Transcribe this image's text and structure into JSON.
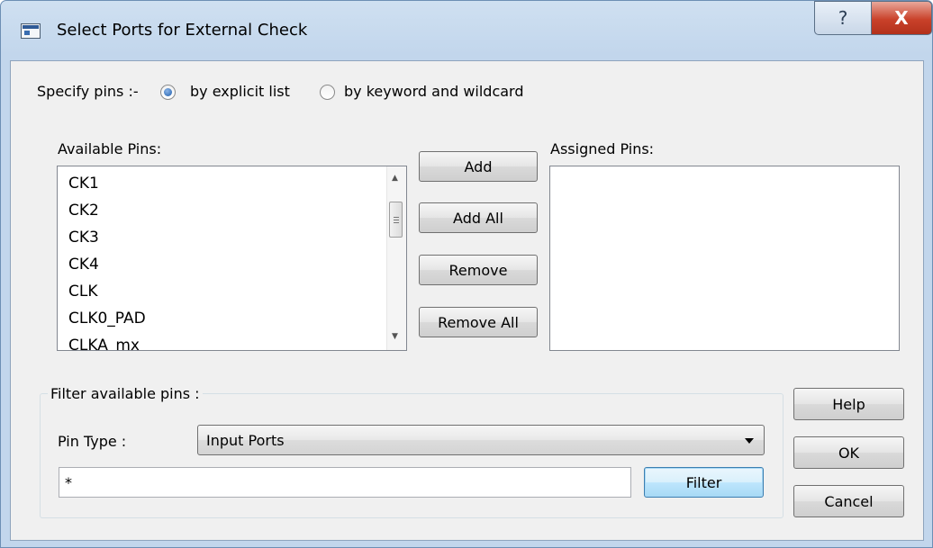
{
  "window": {
    "title": "Select Ports for External Check",
    "help_glyph": "?",
    "close_glyph": "X"
  },
  "specify": {
    "label": "Specify pins :-",
    "options": [
      {
        "label": "by explicit list",
        "selected": true
      },
      {
        "label": "by keyword and wildcard",
        "selected": false
      }
    ]
  },
  "available": {
    "label": "Available Pins:",
    "items": [
      "CK1",
      "CK2",
      "CK3",
      "CK4",
      "CLK",
      "CLK0_PAD",
      "CLKA_mx"
    ]
  },
  "assigned": {
    "label": "Assigned Pins:",
    "items": []
  },
  "buttons": {
    "add": "Add",
    "add_all": "Add All",
    "remove": "Remove",
    "remove_all": "Remove All"
  },
  "filter": {
    "label": "Filter available pins :",
    "pin_type_label": "Pin Type :",
    "pin_type_value": "Input Ports",
    "pattern_value": "*",
    "filter_button": "Filter"
  },
  "side_buttons": {
    "help": "Help",
    "ok": "OK",
    "cancel": "Cancel"
  },
  "colors": {
    "title_gradient": "#c2d6ec",
    "close_red": "#c9412a",
    "dialog_bg": "#f0f0f0",
    "radio_dot": "#1e5dab"
  }
}
